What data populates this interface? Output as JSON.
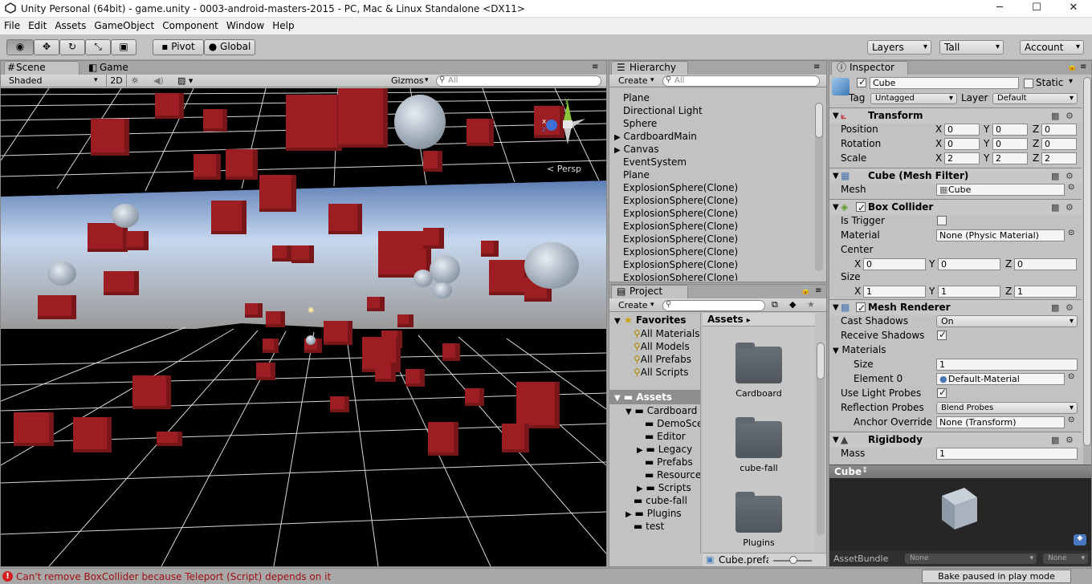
{
  "window": {
    "title": "Unity Personal (64bit) - game.unity - 0003-android-masters-2015 - PC, Mac & Linux Standalone <DX11>"
  },
  "menu": [
    "File",
    "Edit",
    "Assets",
    "GameObject",
    "Component",
    "Window",
    "Help"
  ],
  "toolbar": {
    "pivot": "Pivot",
    "global": "Global",
    "layers": "Layers",
    "layout": "Tall",
    "account": "Account"
  },
  "scene": {
    "tab_scene": "Scene",
    "tab_game": "Game",
    "shading": "Shaded",
    "mode2d": "2D",
    "gizmos": "Gizmos",
    "search_placeholder": "All",
    "persp": "Persp"
  },
  "hierarchy": {
    "tab": "Hierarchy",
    "create": "Create",
    "search_placeholder": "All",
    "items": [
      {
        "label": "Plane",
        "arrow": ""
      },
      {
        "label": "Directional Light",
        "arrow": ""
      },
      {
        "label": "Sphere",
        "arrow": ""
      },
      {
        "label": "CardboardMain",
        "arrow": "▶"
      },
      {
        "label": "Canvas",
        "arrow": "▶"
      },
      {
        "label": "EventSystem",
        "arrow": ""
      },
      {
        "label": "Plane",
        "arrow": ""
      },
      {
        "label": "ExplosionSphere(Clone)",
        "arrow": ""
      },
      {
        "label": "ExplosionSphere(Clone)",
        "arrow": ""
      },
      {
        "label": "ExplosionSphere(Clone)",
        "arrow": ""
      },
      {
        "label": "ExplosionSphere(Clone)",
        "arrow": ""
      },
      {
        "label": "ExplosionSphere(Clone)",
        "arrow": ""
      },
      {
        "label": "ExplosionSphere(Clone)",
        "arrow": ""
      },
      {
        "label": "ExplosionSphere(Clone)",
        "arrow": ""
      },
      {
        "label": "ExplosionSphere(Clone)",
        "arrow": ""
      }
    ]
  },
  "project": {
    "tab": "Project",
    "create": "Create",
    "favorites": "Favorites",
    "fav_items": [
      "All Materials",
      "All Models",
      "All Prefabs",
      "All Scripts"
    ],
    "assets_root": "Assets",
    "breadcrumb": "Assets",
    "tree": [
      {
        "label": "Cardboard",
        "indent": 1,
        "arrow": "▼"
      },
      {
        "label": "DemoScene",
        "indent": 2,
        "arrow": ""
      },
      {
        "label": "Editor",
        "indent": 2,
        "arrow": ""
      },
      {
        "label": "Legacy",
        "indent": 2,
        "arrow": "▶"
      },
      {
        "label": "Prefabs",
        "indent": 2,
        "arrow": ""
      },
      {
        "label": "Resources",
        "indent": 2,
        "arrow": ""
      },
      {
        "label": "Scripts",
        "indent": 2,
        "arrow": "▶"
      },
      {
        "label": "cube-fall",
        "indent": 1,
        "arrow": ""
      },
      {
        "label": "Plugins",
        "indent": 1,
        "arrow": "▶"
      },
      {
        "label": "test",
        "indent": 1,
        "arrow": ""
      }
    ],
    "folders": [
      "Cardboard",
      "cube-fall",
      "Plugins"
    ],
    "selected_file": "Cube.prefab"
  },
  "inspector": {
    "tab": "Inspector",
    "name": "Cube",
    "static_label": "Static",
    "tag_label": "Tag",
    "tag": "Untagged",
    "layer_label": "Layer",
    "layer": "Default",
    "transform": {
      "title": "Transform",
      "position_label": "Position",
      "rotation_label": "Rotation",
      "scale_label": "Scale",
      "position": [
        "0",
        "0",
        "0"
      ],
      "rotation": [
        "0",
        "0",
        "0"
      ],
      "scale": [
        "2",
        "2",
        "2"
      ]
    },
    "mesh_filter": {
      "title": "Cube (Mesh Filter)",
      "mesh_label": "Mesh",
      "mesh": "Cube"
    },
    "box_collider": {
      "title": "Box Collider",
      "is_trigger": "Is Trigger",
      "material_label": "Material",
      "material": "None (Physic Material)",
      "center_label": "Center",
      "center": [
        "0",
        "0",
        "0"
      ],
      "size_label": "Size",
      "size": [
        "1",
        "1",
        "1"
      ]
    },
    "mesh_renderer": {
      "title": "Mesh Renderer",
      "cast_shadows_label": "Cast Shadows",
      "cast_shadows": "On",
      "receive_shadows_label": "Receive Shadows",
      "materials_label": "Materials",
      "size_label": "Size",
      "size": "1",
      "element0_label": "Element 0",
      "element0": "Default-Material",
      "light_probes_label": "Use Light Probes",
      "reflection_probes_label": "Reflection Probes",
      "reflection_probes": "Blend Probes",
      "anchor_override_label": "Anchor Override",
      "anchor_override": "None (Transform)"
    },
    "rigidbody": {
      "title": "Rigidbody",
      "mass_label": "Mass",
      "mass": "1"
    },
    "preview_title": "Cube",
    "assetbundle_label": "AssetBundle",
    "assetbundle": "None",
    "assetbundle_variant": "None",
    "axis": {
      "x": "X",
      "y": "Y",
      "z": "Z"
    }
  },
  "status": {
    "error": "Can't remove BoxCollider because Teleport (Script) depends on it",
    "bake": "Bake paused in play mode"
  },
  "colors": {
    "cube": "#9c1d22",
    "play_active": "#4c84c9"
  }
}
